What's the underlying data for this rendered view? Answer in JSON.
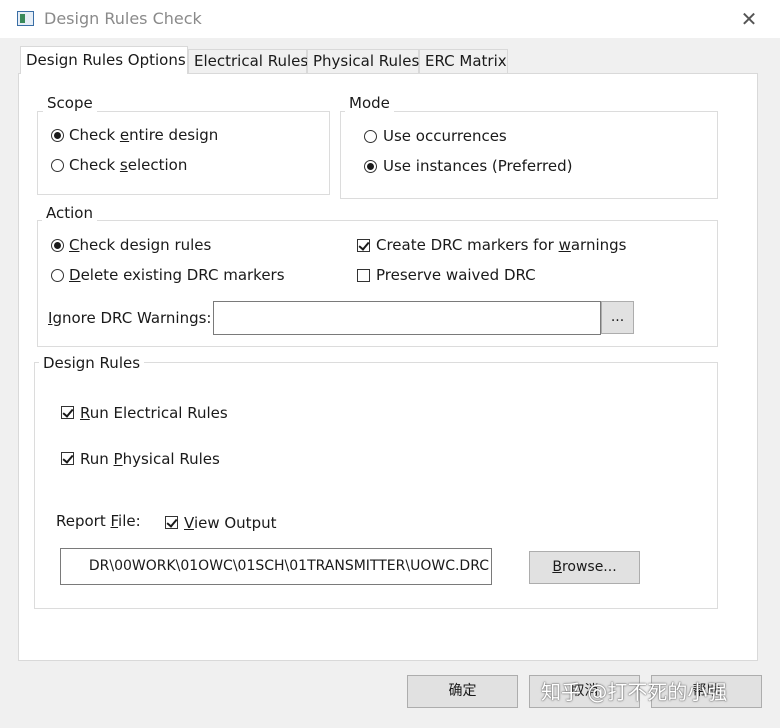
{
  "window": {
    "title": "Design Rules Check"
  },
  "tabs": [
    {
      "label": "Design Rules Options",
      "active": true
    },
    {
      "label": "Electrical Rules",
      "active": false
    },
    {
      "label": "Physical Rules",
      "active": false
    },
    {
      "label": "ERC Matrix",
      "active": false
    }
  ],
  "scope": {
    "title": "Scope",
    "options": [
      {
        "pre": "Check ",
        "key": "e",
        "post": "ntire design",
        "selected": true
      },
      {
        "pre": "Check ",
        "key": "s",
        "post": "election",
        "selected": false
      }
    ]
  },
  "mode": {
    "title": "Mode",
    "options": [
      {
        "label": "Use occurrences",
        "selected": false
      },
      {
        "label": "Use instances (Preferred)",
        "selected": true
      }
    ]
  },
  "action": {
    "title": "Action",
    "radios": [
      {
        "key": "C",
        "post": "heck design rules",
        "selected": true
      },
      {
        "key": "D",
        "post": "elete existing DRC markers",
        "selected": false
      }
    ],
    "checks": [
      {
        "pre": "Create DRC markers for ",
        "key": "w",
        "post": "arnings",
        "checked": true
      },
      {
        "label": "Preserve waived DRC",
        "checked": false
      }
    ],
    "ignore_label_key": "I",
    "ignore_label_post": "gnore DRC Warnings:",
    "ignore_value": "",
    "ellipsis_button": "..."
  },
  "design_rules": {
    "title": "Design Rules",
    "electrical": {
      "key": "R",
      "post": "un Electrical Rules",
      "checked": true
    },
    "physical": {
      "pre": "Run ",
      "key": "P",
      "post": "hysical Rules",
      "checked": true
    },
    "report_label_pre": "Report ",
    "report_label_key": "F",
    "report_label_post": "ile:",
    "view_output": {
      "key": "V",
      "post": "iew Output",
      "checked": true
    },
    "report_path": "DR\\00WORK\\01OWC\\01SCH\\01TRANSMITTER\\UOWC.DRC",
    "browse_key": "B",
    "browse_post": "rowse..."
  },
  "footer": {
    "ok": "确定",
    "cancel": "取消",
    "help": "帮助"
  },
  "watermark": "知乎 @打不死的小强"
}
